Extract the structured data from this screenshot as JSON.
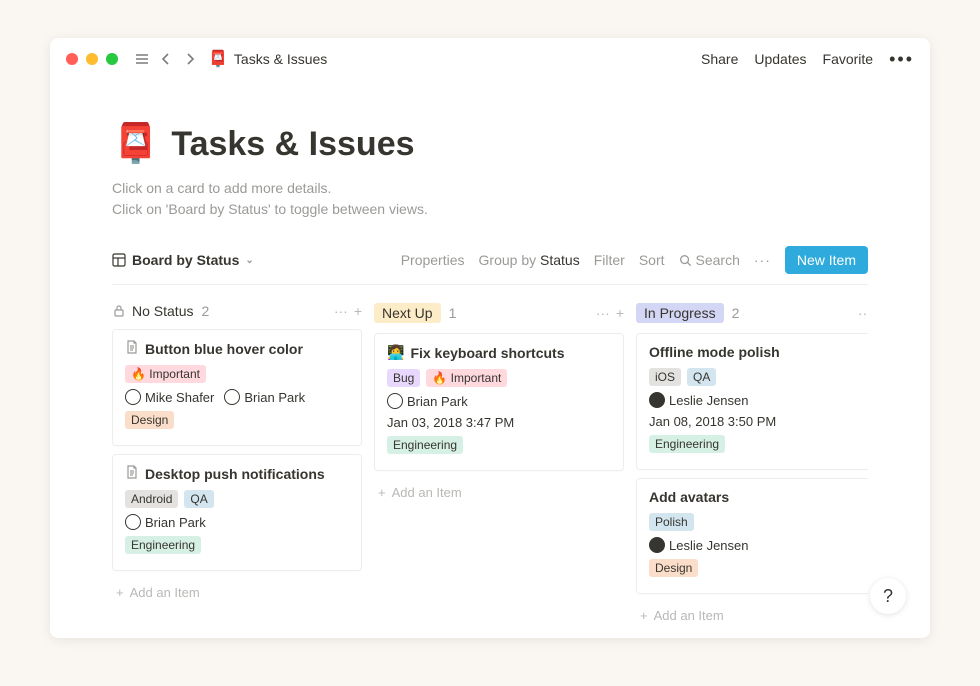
{
  "breadcrumb": {
    "emoji": "📮",
    "title": "Tasks & Issues"
  },
  "topbar": {
    "share": "Share",
    "updates": "Updates",
    "favorite": "Favorite"
  },
  "header": {
    "emoji": "📮",
    "title": "Tasks & Issues",
    "desc1": "Click on a card to add more details.",
    "desc2": "Click on 'Board by Status' to toggle between views."
  },
  "toolbar": {
    "view": "Board by Status",
    "properties": "Properties",
    "group_prefix": "Group by ",
    "group_value": "Status",
    "filter": "Filter",
    "sort": "Sort",
    "search": "Search",
    "new": "New Item"
  },
  "board": {
    "columns": [
      {
        "id": "nostatus",
        "title": "No Status",
        "count": "2",
        "pill_class": "nostatus",
        "cards": [
          {
            "icon": "page",
            "title": "Button blue hover color",
            "tags1": [
              {
                "label": "🔥 Important",
                "cls": "important"
              }
            ],
            "people": [
              {
                "name": "Mike Shafer",
                "avatar": "light"
              },
              {
                "name": "Brian Park",
                "avatar": "light"
              }
            ],
            "tags2": [
              {
                "label": "Design",
                "cls": "design"
              }
            ]
          },
          {
            "icon": "page",
            "title": "Desktop push notifications",
            "tags1": [
              {
                "label": "Android",
                "cls": "android"
              },
              {
                "label": "QA",
                "cls": "qa"
              }
            ],
            "people": [
              {
                "name": "Brian Park",
                "avatar": "light"
              }
            ],
            "tags2": [
              {
                "label": "Engineering",
                "cls": "engineering"
              }
            ]
          }
        ]
      },
      {
        "id": "nextup",
        "title": "Next Up",
        "count": "1",
        "pill_class": "nextup",
        "cards": [
          {
            "icon": "emoji",
            "emoji": "👩‍💻",
            "title": "Fix keyboard shortcuts",
            "tags1": [
              {
                "label": "Bug",
                "cls": "bug"
              },
              {
                "label": "🔥 Important",
                "cls": "important"
              }
            ],
            "people": [
              {
                "name": "Brian Park",
                "avatar": "light"
              }
            ],
            "date": "Jan 03, 2018 3:47 PM",
            "tags2": [
              {
                "label": "Engineering",
                "cls": "engineering"
              }
            ]
          }
        ]
      },
      {
        "id": "inprogress",
        "title": "In Progress",
        "count": "2",
        "pill_class": "inprogress",
        "cards": [
          {
            "icon": "none",
            "title": "Offline mode polish",
            "tags1": [
              {
                "label": "iOS",
                "cls": "ios"
              },
              {
                "label": "QA",
                "cls": "qa"
              }
            ],
            "people": [
              {
                "name": "Leslie Jensen",
                "avatar": "dark"
              }
            ],
            "date": "Jan 08, 2018 3:50 PM",
            "tags2": [
              {
                "label": "Engineering",
                "cls": "engineering"
              }
            ]
          },
          {
            "icon": "none",
            "title": "Add avatars",
            "tags1": [
              {
                "label": "Polish",
                "cls": "polish"
              }
            ],
            "people": [
              {
                "name": "Leslie Jensen",
                "avatar": "dark"
              }
            ],
            "tags2": [
              {
                "label": "Design",
                "cls": "design"
              }
            ]
          }
        ]
      }
    ],
    "add_item": "Add an Item"
  },
  "help": "?"
}
